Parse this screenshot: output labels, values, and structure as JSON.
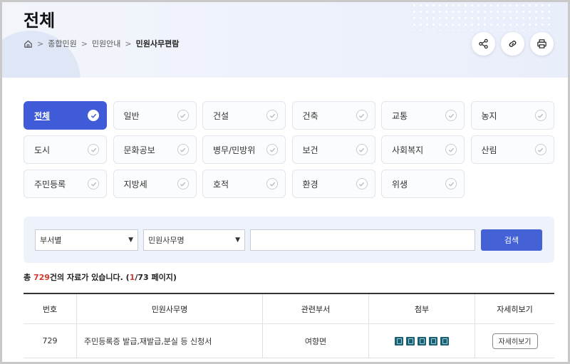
{
  "header": {
    "title": "전체",
    "breadcrumb": [
      "종합민원",
      "민원안내",
      "민원사무편람"
    ]
  },
  "toolbar": {
    "icons": [
      "share-icon",
      "link-icon",
      "print-icon"
    ]
  },
  "categories": [
    {
      "label": "전체",
      "active": true
    },
    {
      "label": "일반",
      "active": false
    },
    {
      "label": "건설",
      "active": false
    },
    {
      "label": "건축",
      "active": false
    },
    {
      "label": "교통",
      "active": false
    },
    {
      "label": "농지",
      "active": false
    },
    {
      "label": "도시",
      "active": false
    },
    {
      "label": "문화공보",
      "active": false
    },
    {
      "label": "병무/민방위",
      "active": false
    },
    {
      "label": "보건",
      "active": false
    },
    {
      "label": "사회복지",
      "active": false
    },
    {
      "label": "산림",
      "active": false
    },
    {
      "label": "주민등록",
      "active": false
    },
    {
      "label": "지방세",
      "active": false
    },
    {
      "label": "호적",
      "active": false
    },
    {
      "label": "환경",
      "active": false
    },
    {
      "label": "위생",
      "active": false
    }
  ],
  "search": {
    "select1": "부서별",
    "select2": "민원사무명",
    "input_value": "",
    "button": "검색"
  },
  "summary": {
    "prefix": "총 ",
    "count": "729",
    "middle": "건의 자료가 있습니다. (",
    "page": "1",
    "suffix": "/73 페이지)"
  },
  "table": {
    "headers": [
      "번호",
      "민원사무명",
      "관련부서",
      "첨부",
      "자세히보기"
    ],
    "rows": [
      {
        "no": "729",
        "name": "주민등록증 발급,재발급,분실 등 신청서",
        "dept": "여향면",
        "attachments": 5,
        "detail": "자세히보기"
      }
    ]
  },
  "colors": {
    "accent": "#3f5bd8",
    "count_red": "#d23b2c",
    "attachment": "#1d5f72"
  }
}
